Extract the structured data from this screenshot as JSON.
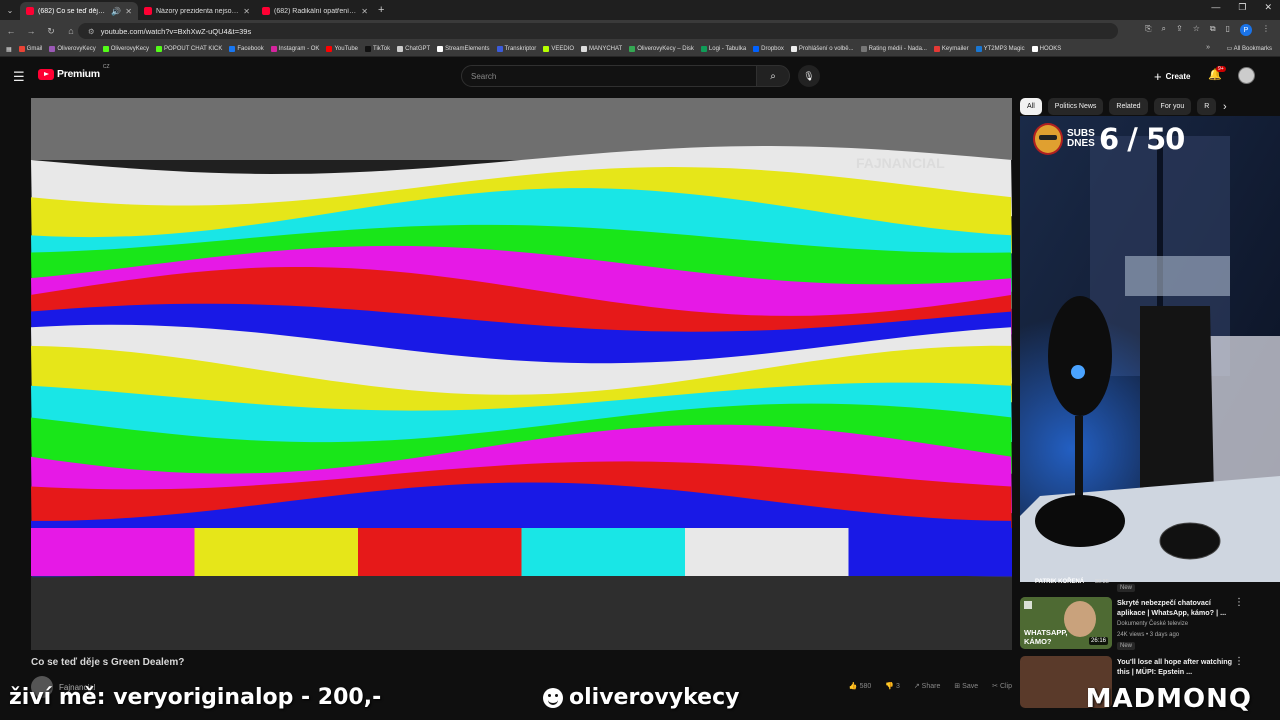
{
  "browser": {
    "tabs": [
      {
        "label": "(682) Co se teď děje s Green",
        "active": true
      },
      {
        "label": "Názory prezidenta nejsou rele",
        "active": false
      },
      {
        "label": "(682) Radikální opatření vlády",
        "active": false
      }
    ],
    "url": "youtube.com/watch?v=BxhXwZ-uQU4&t=39s",
    "profile_initial": "P",
    "bookmarks": [
      "Gmail",
      "OliverovyKecy",
      "OliverovyKecy",
      "POPOUT CHAT KICK",
      "Facebook",
      "Instagram - OK",
      "YouTube",
      "TikTok",
      "ChatGPT",
      "StreamElements",
      "Transkriptor",
      "VEEDIO",
      "MANYCHAT",
      "OliverovyKecy – Disk",
      "Logi - Tabulka",
      "Dropbox",
      "Prohlášení o volbě...",
      "Rating médií - Nada...",
      "Keymailer",
      "YT2MP3 Magic",
      "HOOKS"
    ],
    "all_bookmarks": "All Bookmarks"
  },
  "youtube": {
    "logo_text": "Premium",
    "country": "CZ",
    "search_placeholder": "Search",
    "create_label": "Create",
    "notification_count": "9+"
  },
  "video": {
    "title": "Co se teď děje s Green Dealem?",
    "channel": "Fajnancial",
    "watermark": "FAJNANCIAL",
    "actions": [
      "580",
      "3",
      "Share",
      "Save",
      "Clip"
    ],
    "bar_colors": [
      "#e8e8e8",
      "#e6e619",
      "#19e6e6",
      "#19e619",
      "#e619e6",
      "#e61919",
      "#1919e6"
    ]
  },
  "chips": [
    "All",
    "Politics News",
    "Related",
    "For you",
    "R"
  ],
  "overlay": {
    "subs_label": "SUBS DNES",
    "subs_count": "6 / 50",
    "cam_name": "PATRIK KOŘENÁ",
    "cam_time": "30:35",
    "left_text": "živí mě: veryoriginalop - 200,-",
    "center_text": "oliverovykecy",
    "right_text": "MADMONQ"
  },
  "recommended": [
    {
      "title": "Skryté nebezpečí chatovací aplikace | WhatsApp, kámo? | ...",
      "channel": "Dokumenty České televize",
      "meta": "24K views • 3 days ago",
      "badge": "New",
      "duration": "26:16",
      "thumb_text": "WHATSAPP, KÁMO?"
    },
    {
      "title": "You'll lose all hope after watching this | MÜPI: Epstein ...",
      "channel": "",
      "meta": "",
      "badge": "",
      "duration": "",
      "thumb_text": ""
    }
  ],
  "new_badge_top": "New"
}
